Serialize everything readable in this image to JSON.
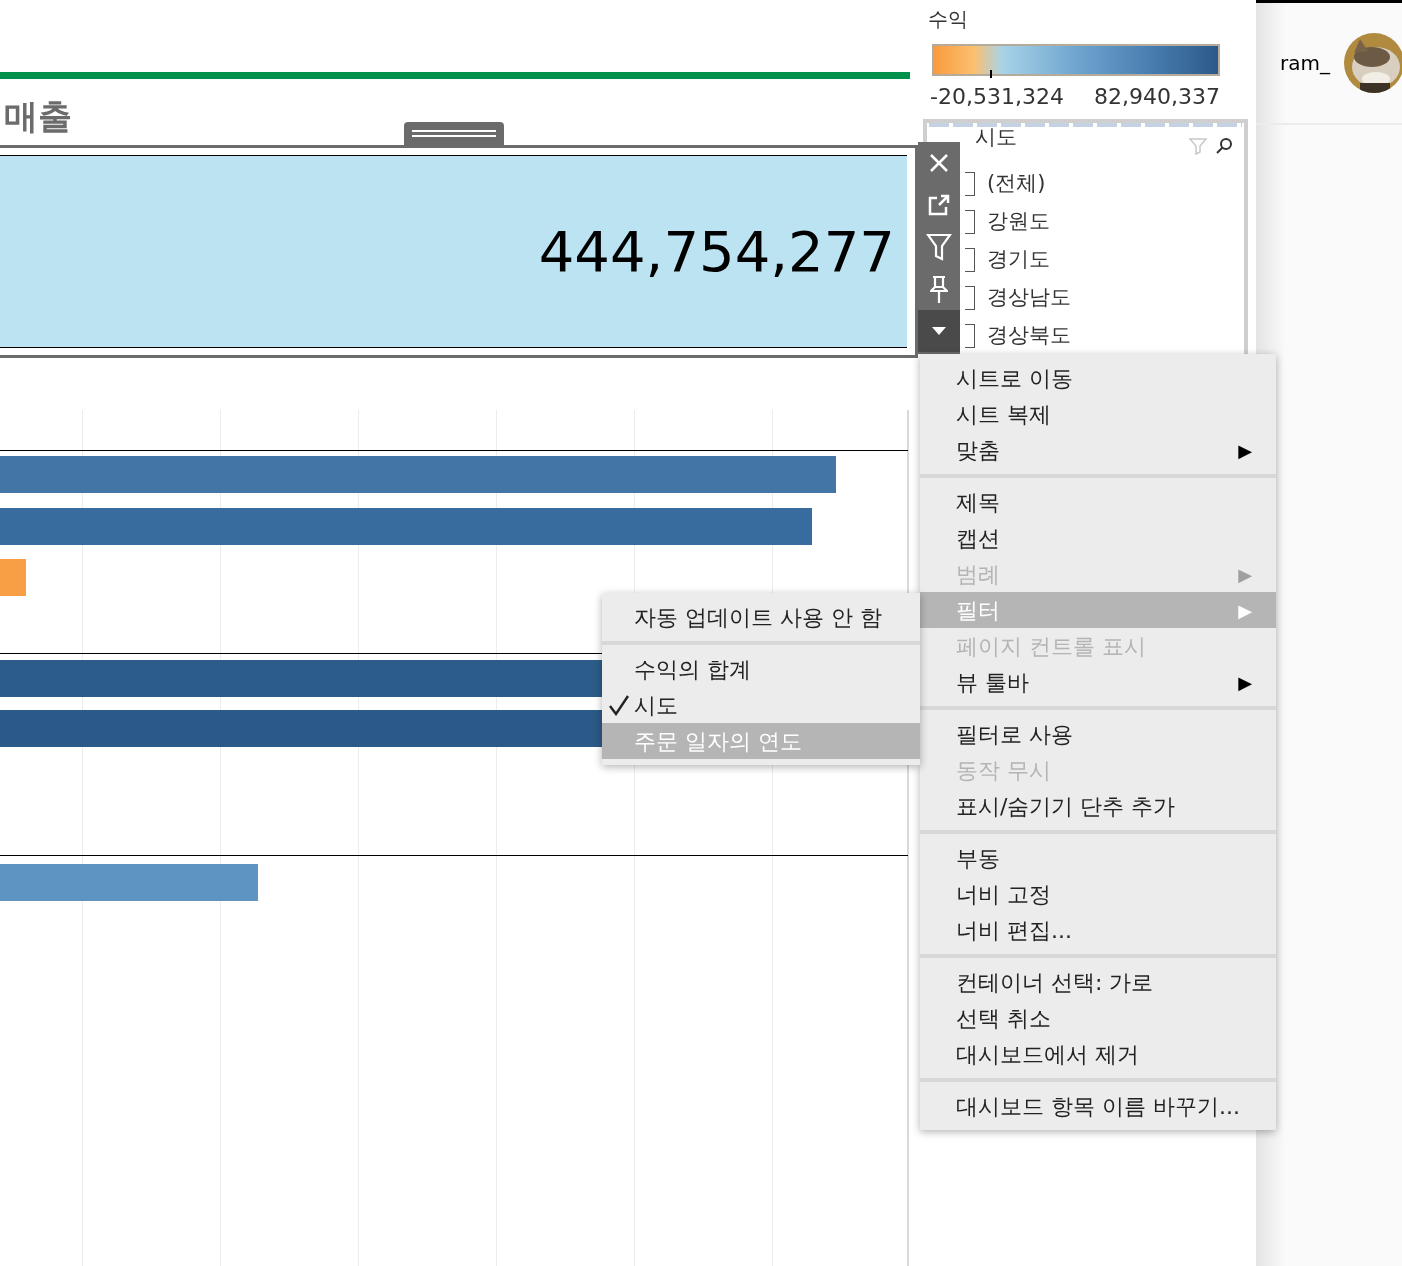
{
  "sales_title": "매출",
  "kpi": {
    "value": "444,754,277"
  },
  "chart": {
    "bars": [
      {
        "color": "#4375a6"
      },
      {
        "color": "#386b9e"
      },
      {
        "color": "#f89e45"
      },
      {
        "color": "#2c5d8a"
      },
      {
        "color": "#2c5a88"
      },
      {
        "color": "#5e94c2"
      }
    ]
  },
  "legend": {
    "title": "수익",
    "min": "-20,531,324",
    "max": "82,940,337"
  },
  "filter": {
    "title": "시도",
    "items": [
      {
        "label": "(전체)",
        "checked": false
      },
      {
        "label": "강원도",
        "checked": false
      },
      {
        "label": "경기도",
        "checked": false
      },
      {
        "label": "경상남도",
        "checked": false
      },
      {
        "label": "경상북도",
        "checked": false
      }
    ]
  },
  "user": {
    "name": "ram_"
  },
  "context_menu": {
    "sections": [
      [
        {
          "label": "시트로 이동",
          "disabled": false,
          "selected": false
        },
        {
          "label": "시트 복제",
          "disabled": false,
          "selected": false
        },
        {
          "label": "맞춤",
          "disabled": false,
          "selected": false,
          "arrow": "▶"
        }
      ],
      [
        {
          "label": "제목",
          "disabled": false,
          "selected": false
        },
        {
          "label": "캡션",
          "disabled": false,
          "selected": false
        },
        {
          "label": "범례",
          "disabled": true,
          "selected": false,
          "arrow": "▶"
        },
        {
          "label": "필터",
          "disabled": false,
          "selected": true,
          "arrow": "▶"
        },
        {
          "label": "페이지 컨트롤 표시",
          "disabled": true,
          "selected": false
        },
        {
          "label": "뷰 툴바",
          "disabled": false,
          "selected": false,
          "arrow": "▶"
        }
      ],
      [
        {
          "label": "필터로 사용",
          "disabled": false,
          "selected": false
        },
        {
          "label": "동작 무시",
          "disabled": true,
          "selected": false
        },
        {
          "label": "표시/숨기기 단추 추가",
          "disabled": false,
          "selected": false
        }
      ],
      [
        {
          "label": "부동",
          "disabled": false,
          "selected": false
        },
        {
          "label": "너비 고정",
          "disabled": false,
          "selected": false
        },
        {
          "label": "너비 편집...",
          "disabled": false,
          "selected": false
        }
      ],
      [
        {
          "label": "컨테이너 선택: 가로",
          "disabled": false,
          "selected": false
        },
        {
          "label": "선택 취소",
          "disabled": false,
          "selected": false
        },
        {
          "label": "대시보드에서 제거",
          "disabled": false,
          "selected": false
        }
      ],
      [
        {
          "label": "대시보드 항목 이름 바꾸기...",
          "disabled": false,
          "selected": false
        }
      ]
    ]
  },
  "submenu": {
    "sections": [
      [
        {
          "label": "자동 업데이트 사용 안 함",
          "checked": false,
          "selected": false
        }
      ],
      [
        {
          "label": "수익의 합계",
          "checked": false,
          "selected": false
        },
        {
          "label": "시도",
          "checked": true,
          "selected": false
        },
        {
          "label": "주문 일자의 연도",
          "checked": false,
          "selected": true
        }
      ]
    ]
  }
}
